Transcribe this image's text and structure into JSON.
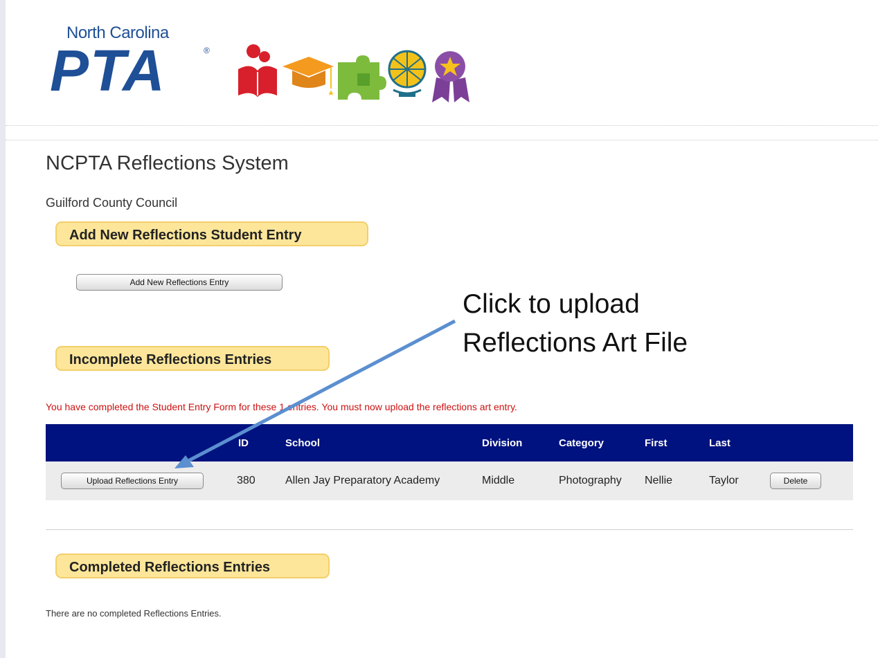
{
  "header": {
    "logo_state": "North Carolina",
    "logo_pta": "PTA",
    "logo_reg": "®"
  },
  "icons": [
    "reader-icon",
    "graduation-cap-icon",
    "puzzle-icon",
    "globe-icon",
    "award-ribbon-icon"
  ],
  "page_title": "NCPTA Reflections System",
  "council": "Guilford County Council",
  "sections": {
    "add": {
      "heading": "Add New Reflections Student Entry",
      "button_label": "Add New Reflections Entry"
    },
    "incomplete": {
      "heading": "Incomplete Reflections Entries",
      "notice": "You have completed the Student Entry Form for these 1 entries. You must now upload the reflections art entry.",
      "columns": [
        "ID",
        "School",
        "Division",
        "Category",
        "First",
        "Last"
      ],
      "rows": [
        {
          "action_label": "Upload Reflections Entry",
          "id": "380",
          "school": "Allen Jay Preparatory Academy",
          "division": "Middle",
          "category": "Photography",
          "first": "Nellie",
          "last": "Taylor",
          "delete_label": "Delete"
        }
      ]
    },
    "completed": {
      "heading": "Completed Reflections Entries",
      "empty_message": "There are no completed Reflections Entries."
    }
  },
  "annotation": {
    "line1": "Click to upload",
    "line2": "Reflections Art File"
  },
  "colors": {
    "table_header": "#00127f",
    "pill_bg": "#fde69a",
    "notice": "#cc1111",
    "logo_blue": "#1f4f96",
    "arrow": "#5b8fd0"
  }
}
